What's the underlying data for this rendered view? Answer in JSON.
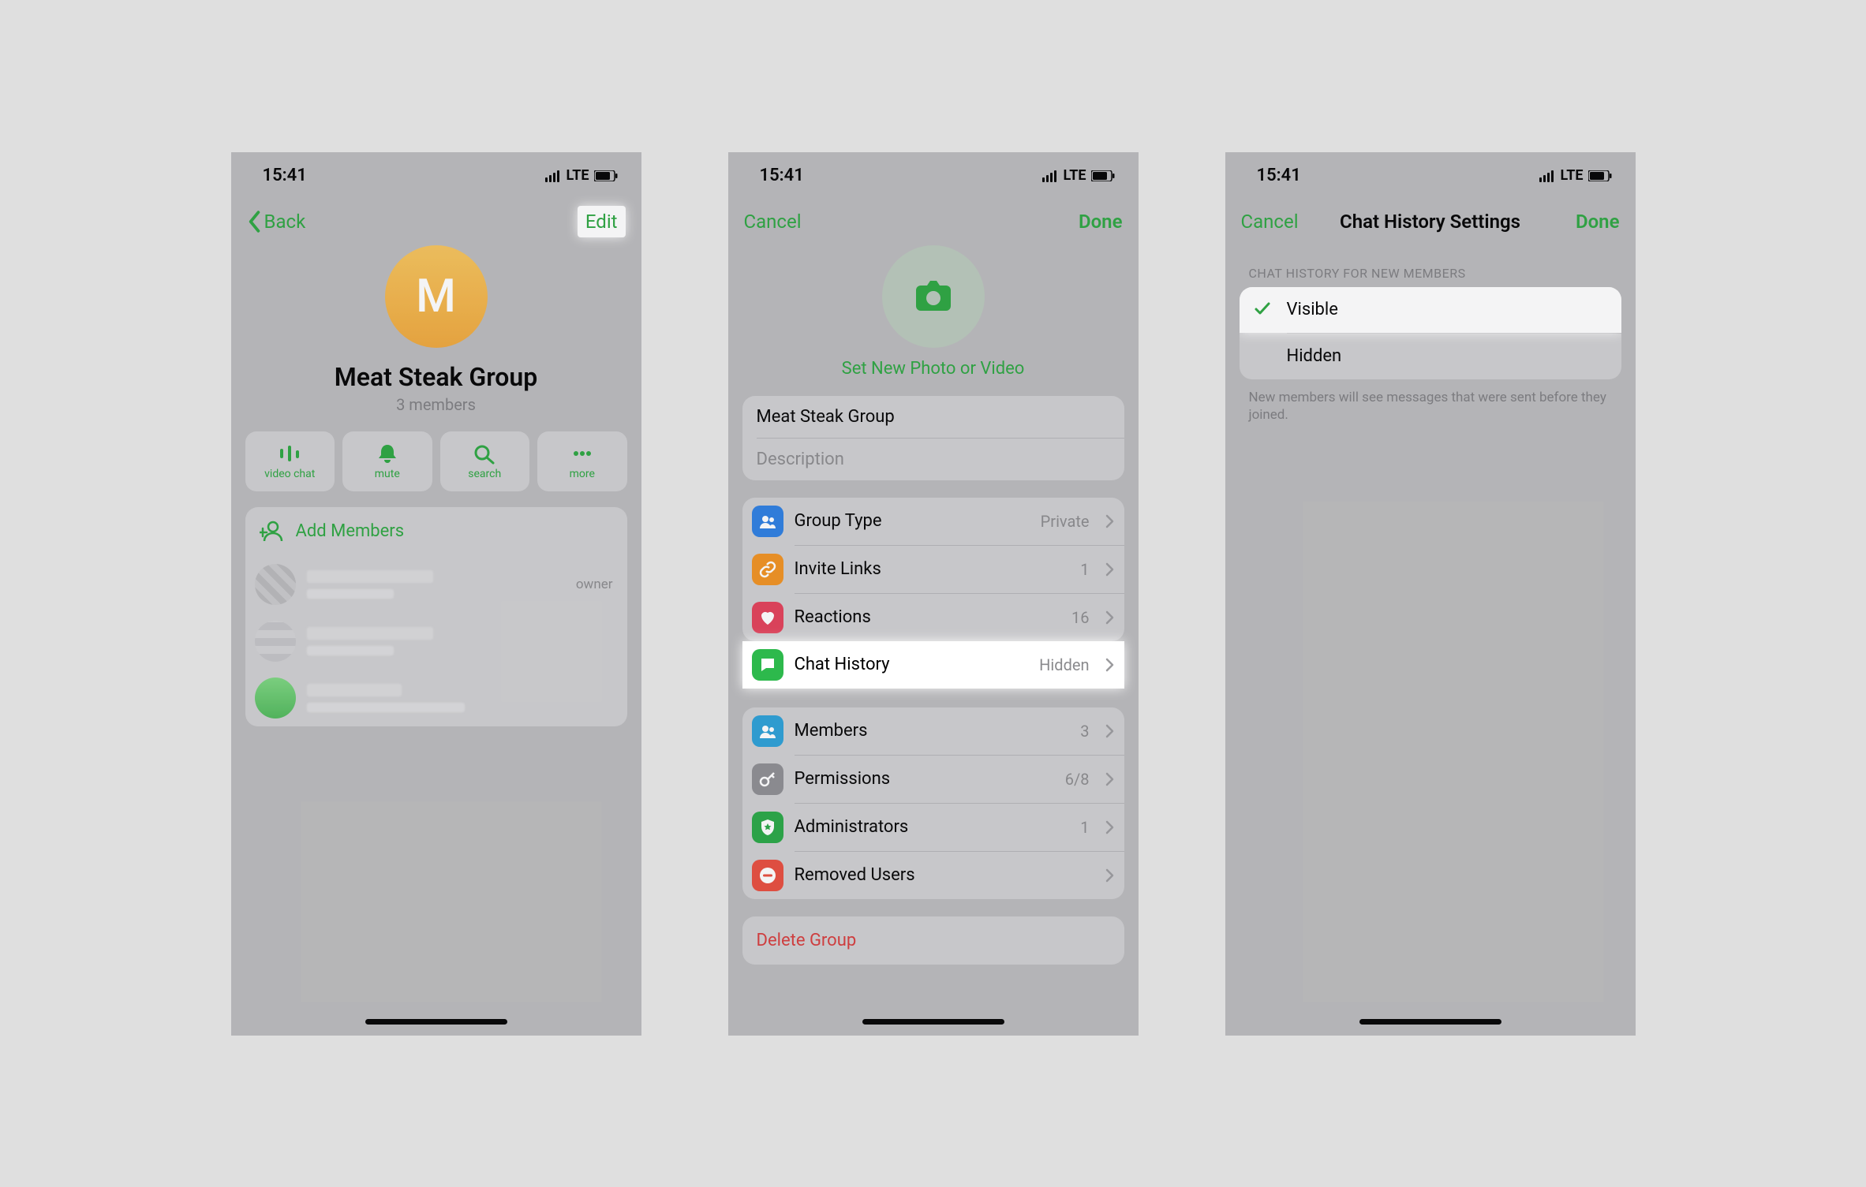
{
  "status": {
    "time": "15:41",
    "net": "LTE"
  },
  "s1": {
    "back": "Back",
    "edit": "Edit",
    "initial": "M",
    "name": "Meat Steak Group",
    "members": "3 members",
    "actions": {
      "video": "video chat",
      "mute": "mute",
      "search": "search",
      "more": "more"
    },
    "add": "Add Members",
    "owner": "owner"
  },
  "s2": {
    "cancel": "Cancel",
    "done": "Done",
    "setphoto": "Set New Photo or Video",
    "name": "Meat Steak Group",
    "desc_placeholder": "Description",
    "rows": {
      "grouptype": {
        "label": "Group Type",
        "value": "Private"
      },
      "invite": {
        "label": "Invite Links",
        "value": "1"
      },
      "reactions": {
        "label": "Reactions",
        "value": "16"
      },
      "history": {
        "label": "Chat History",
        "value": "Hidden"
      },
      "members": {
        "label": "Members",
        "value": "3"
      },
      "perms": {
        "label": "Permissions",
        "value": "6/8"
      },
      "admins": {
        "label": "Administrators",
        "value": "1"
      },
      "removed": {
        "label": "Removed Users",
        "value": ""
      }
    },
    "delete": "Delete Group"
  },
  "s3": {
    "cancel": "Cancel",
    "title": "Chat History Settings",
    "done": "Done",
    "header": "CHAT HISTORY FOR NEW MEMBERS",
    "visible": "Visible",
    "hidden": "Hidden",
    "foot": "New members will see messages that were sent before they joined."
  }
}
